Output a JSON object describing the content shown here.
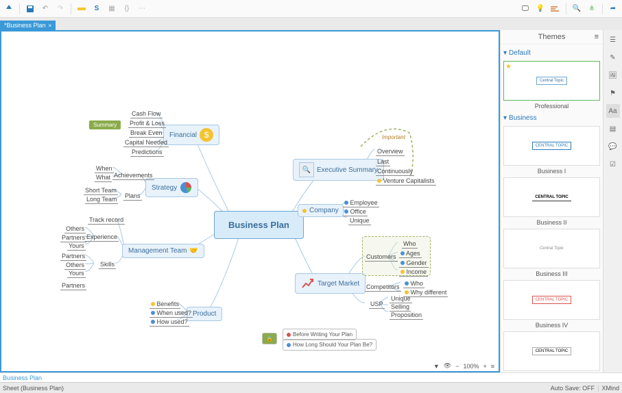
{
  "tab": {
    "title": "*Business Plan",
    "close": "×"
  },
  "central": "Business Plan",
  "nodes": {
    "financial": "Financial",
    "strategy": "Strategy",
    "mgmt": "Management Team",
    "product": "Product",
    "exec": "Executive Summary",
    "company": "Company",
    "target": "Target Market"
  },
  "sub": {
    "fin1": "Cash Flow",
    "fin2": "Profit & Loss",
    "fin3": "Break Even",
    "fin4": "Capital Needed",
    "fin5": "Predictions",
    "str_ach": "Achievements",
    "str_plans": "Plans",
    "str1": "When",
    "str2": "What",
    "str3": "Short Team",
    "str4": "Long Team",
    "mg_tr": "Track record",
    "mg_exp": "Experience",
    "mg_sk": "Skills",
    "mg1": "Others",
    "mg2": "Partners",
    "mg3": "Yours",
    "mg4": "Partners",
    "mg5": "Others",
    "mg6": "Yours",
    "mg7": "Partners",
    "pr1": "Benefits",
    "pr2": "When used?",
    "pr3": "How used?",
    "ex1": "Overview",
    "ex2": "Last",
    "ex3": "Continuously",
    "ex4": "Venture Capitalists",
    "co1": "Employee",
    "co2": "Office",
    "co3": "Unique",
    "tm_cust": "Customers",
    "tm_comp": "Competitors",
    "tm_usp": "USP",
    "tm1": "Who",
    "tm2": "Ages",
    "tm3": "Gender",
    "tm4": "Income",
    "tm5": "Who",
    "tm6": "Why different",
    "tm7": "Unique",
    "tm8": "Selling",
    "tm9": "Proposition"
  },
  "summary": "Summary",
  "important": "Important",
  "float1": "Before Writing Your Plan",
  "float2": "How Long Should Your Plan Be?",
  "panel": {
    "title": "Themes",
    "default": "Default",
    "business": "Business",
    "t1": "Professional",
    "t2": "Business I",
    "t3": "Business II",
    "t4": "Business III",
    "t5": "Business IV",
    "ct": "Central Topic",
    "ctU": "CENTRAL TOPIC"
  },
  "bottom_tab": "Business Plan",
  "status": {
    "sheet": "Sheet (Business Plan)",
    "autosave": "Auto Save: OFF",
    "brand": "XMind"
  },
  "zoom": "100%"
}
